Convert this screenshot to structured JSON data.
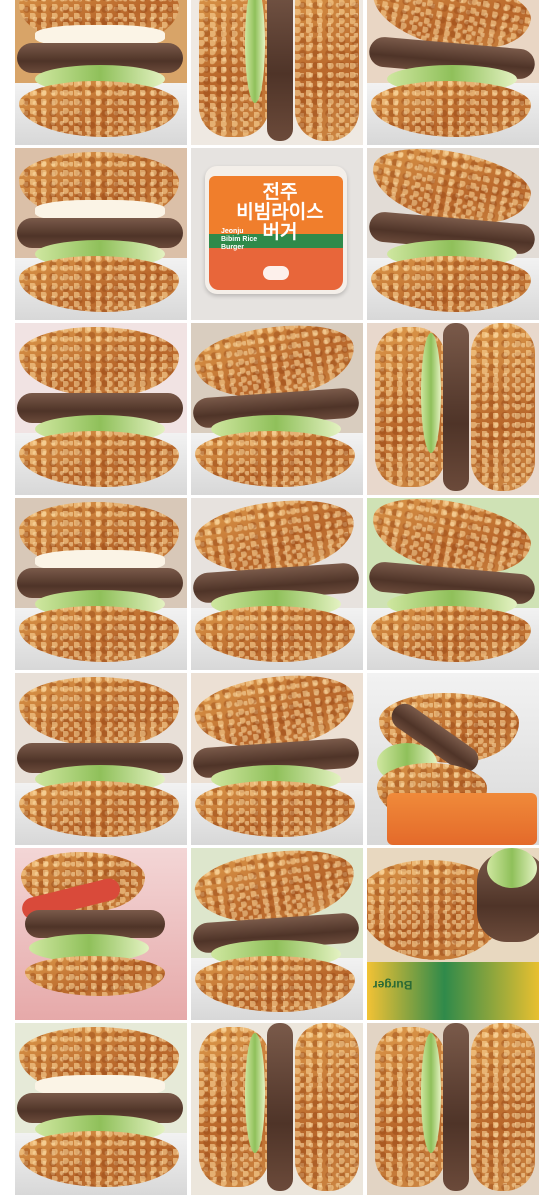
{
  "gallery": {
    "tiles": [
      {
        "name": "burger-photo-1",
        "kind": "egg-front"
      },
      {
        "name": "burger-photo-2",
        "kind": "side-cut"
      },
      {
        "name": "burger-photo-3",
        "kind": "bite-angle"
      },
      {
        "name": "burger-photo-4",
        "kind": "egg-side"
      },
      {
        "name": "burger-photo-5",
        "kind": "package"
      },
      {
        "name": "burger-photo-6",
        "kind": "stack"
      },
      {
        "name": "burger-photo-7",
        "kind": "tilted"
      },
      {
        "name": "burger-photo-8",
        "kind": "hand-held"
      },
      {
        "name": "burger-photo-9",
        "kind": "half-cut"
      },
      {
        "name": "burger-photo-10",
        "kind": "egg-front"
      },
      {
        "name": "burger-photo-11",
        "kind": "lettuce-front"
      },
      {
        "name": "burger-photo-12",
        "kind": "lettuce-top"
      },
      {
        "name": "burger-photo-13",
        "kind": "lettuce-side"
      },
      {
        "name": "burger-photo-14",
        "kind": "lettuce-front"
      },
      {
        "name": "burger-photo-15",
        "kind": "orange-wrap"
      },
      {
        "name": "burger-photo-16",
        "kind": "tomato"
      },
      {
        "name": "burger-photo-17",
        "kind": "lettuce-front"
      },
      {
        "name": "burger-photo-18",
        "kind": "box-label"
      },
      {
        "name": "burger-photo-19",
        "kind": "egg-side"
      },
      {
        "name": "burger-photo-20",
        "kind": "side-cut"
      },
      {
        "name": "burger-photo-21",
        "kind": "half-cut"
      }
    ],
    "package": {
      "title": "전주\n비빔라이스\n버거",
      "subtitle": "Jeonju\nBibim Rice\nBurger"
    },
    "box_label": "Burger"
  }
}
